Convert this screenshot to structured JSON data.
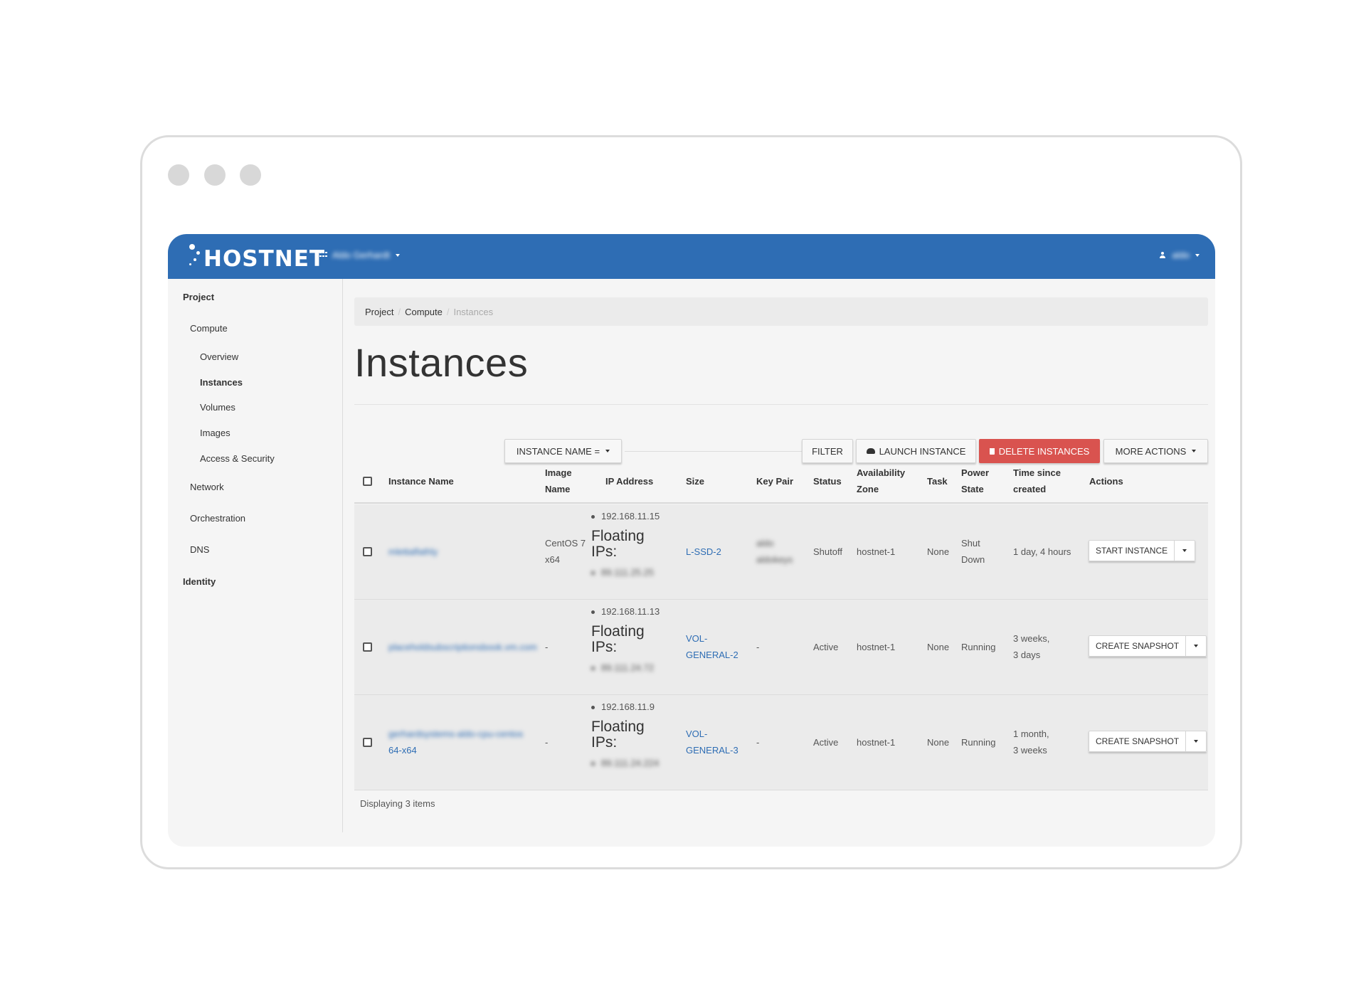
{
  "brand": {
    "name": "HOSTNET",
    "accent": "#2e6db4",
    "danger": "#d9534f"
  },
  "topbar": {
    "project_selector": "Aldo Gerhardt",
    "user": "aldo"
  },
  "sidebar": {
    "project": "Project",
    "compute": "Compute",
    "items": [
      "Overview",
      "Instances",
      "Volumes",
      "Images",
      "Access & Security"
    ],
    "network": "Network",
    "orchestration": "Orchestration",
    "dns": "DNS",
    "identity": "Identity"
  },
  "breadcrumb": [
    "Project",
    "Compute",
    "Instances"
  ],
  "page_title": "Instances",
  "toolbar": {
    "instance_name_filter": "INSTANCE NAME =",
    "filter": "FILTER",
    "launch": "LAUNCH INSTANCE",
    "delete": "DELETE INSTANCES",
    "more": "MORE ACTIONS"
  },
  "table": {
    "columns": {
      "name": "Instance Name",
      "image_1": "Image",
      "image_2": "Name",
      "ip": "IP Address",
      "size": "Size",
      "keypair": "Key Pair",
      "status": "Status",
      "az_1": "Availability",
      "az_2": "Zone",
      "task": "Task",
      "power_1": "Power",
      "power_2": "State",
      "time_1": "Time since",
      "time_2": "created",
      "actions": "Actions"
    },
    "floating_label_1": "Floating",
    "floating_label_2": "IPs:",
    "rows": [
      {
        "name_1": "mlettalfathly",
        "name_2": "",
        "image_1": "CentOS 7",
        "image_2": "x64",
        "fixed_ip": "192.168.11.15",
        "floating_ip": "89.111.25.25",
        "size_1": "L-SSD-2",
        "size_2": "",
        "keypair_1": "aldo",
        "keypair_2": "aldokeys",
        "status": "Shutoff",
        "az": "hostnet-1",
        "task": "None",
        "power_1": "Shut",
        "power_2": "Down",
        "time_1": "1 day, 4 hours",
        "time_2": "",
        "action": "START INSTANCE"
      },
      {
        "name_1": "placeholdsubscriptionsbook.vm.com",
        "name_2": "",
        "image_1": "-",
        "image_2": "",
        "fixed_ip": "192.168.11.13",
        "floating_ip": "89.111.24.72",
        "size_1": "VOL-",
        "size_2": "GENERAL-2",
        "keypair_1": "-",
        "keypair_2": "",
        "status": "Active",
        "az": "hostnet-1",
        "task": "None",
        "power_1": "Running",
        "power_2": "",
        "time_1": "3 weeks,",
        "time_2": "3 days",
        "action": "CREATE SNAPSHOT"
      },
      {
        "name_1": "gerhardsystems-aldo-cpu-centos",
        "name_2": "64-x64",
        "image_1": "-",
        "image_2": "",
        "fixed_ip": "192.168.11.9",
        "floating_ip": "89.111.24.224",
        "size_1": "VOL-",
        "size_2": "GENERAL-3",
        "keypair_1": "-",
        "keypair_2": "",
        "status": "Active",
        "az": "hostnet-1",
        "task": "None",
        "power_1": "Running",
        "power_2": "",
        "time_1": "1 month,",
        "time_2": "3 weeks",
        "action": "CREATE SNAPSHOT"
      }
    ],
    "footer": "Displaying 3 items"
  }
}
